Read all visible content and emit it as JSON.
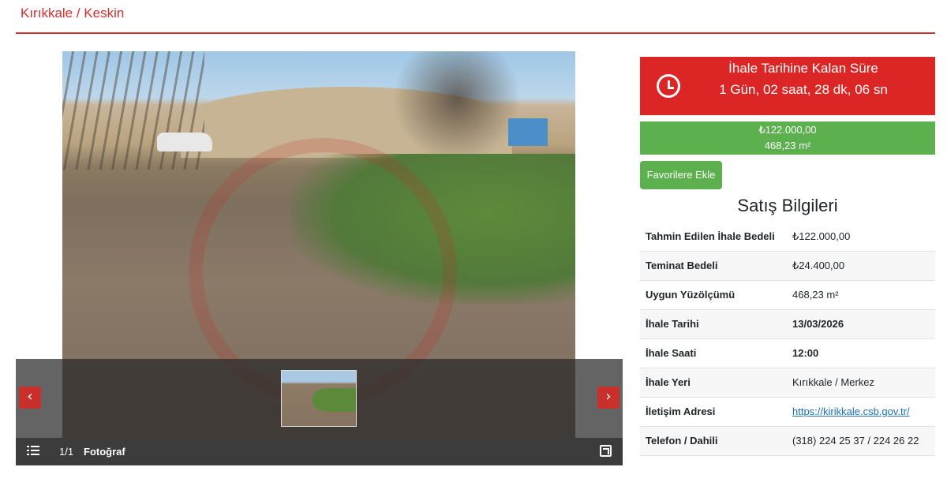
{
  "header": {
    "location": "Kırıkkale / Keskin"
  },
  "gallery": {
    "counter": "1/1",
    "label": "Fotoğraf",
    "prev_icon": "‹",
    "next_icon": "›"
  },
  "countdown": {
    "title": "İhale Tarihine Kalan Süre",
    "time": "1 Gün, 02 saat, 28 dk, 06 sn"
  },
  "price": {
    "amount": "₺122.000,00",
    "area": "468,23 m²"
  },
  "actions": {
    "favorite_label": "Favorilere Ekle"
  },
  "sales_info": {
    "title": "Satış Bilgileri",
    "rows": [
      {
        "label": "Tahmin Edilen İhale Bedeli",
        "value": "₺122.000,00"
      },
      {
        "label": "Teminat Bedeli",
        "value": "₺24.400,00"
      },
      {
        "label": "Uygun Yüzölçümü",
        "value": "468,23 m²"
      },
      {
        "label": "İhale Tarihi",
        "value": "13/03/2026"
      },
      {
        "label": "İhale Saati",
        "value": "12:00"
      },
      {
        "label": "İhale Yeri",
        "value": "Kırıkkale / Merkez"
      },
      {
        "label": "İletişim Adresi",
        "value": "https://kirikkale.csb.gov.tr/"
      },
      {
        "label": "Telefon / Dahili",
        "value": "(318) 224 25 37 / 224 26 22"
      }
    ]
  },
  "colors": {
    "accent_red": "#dc2626",
    "accent_green": "#5cb04d",
    "link": "#1a6fb5"
  }
}
